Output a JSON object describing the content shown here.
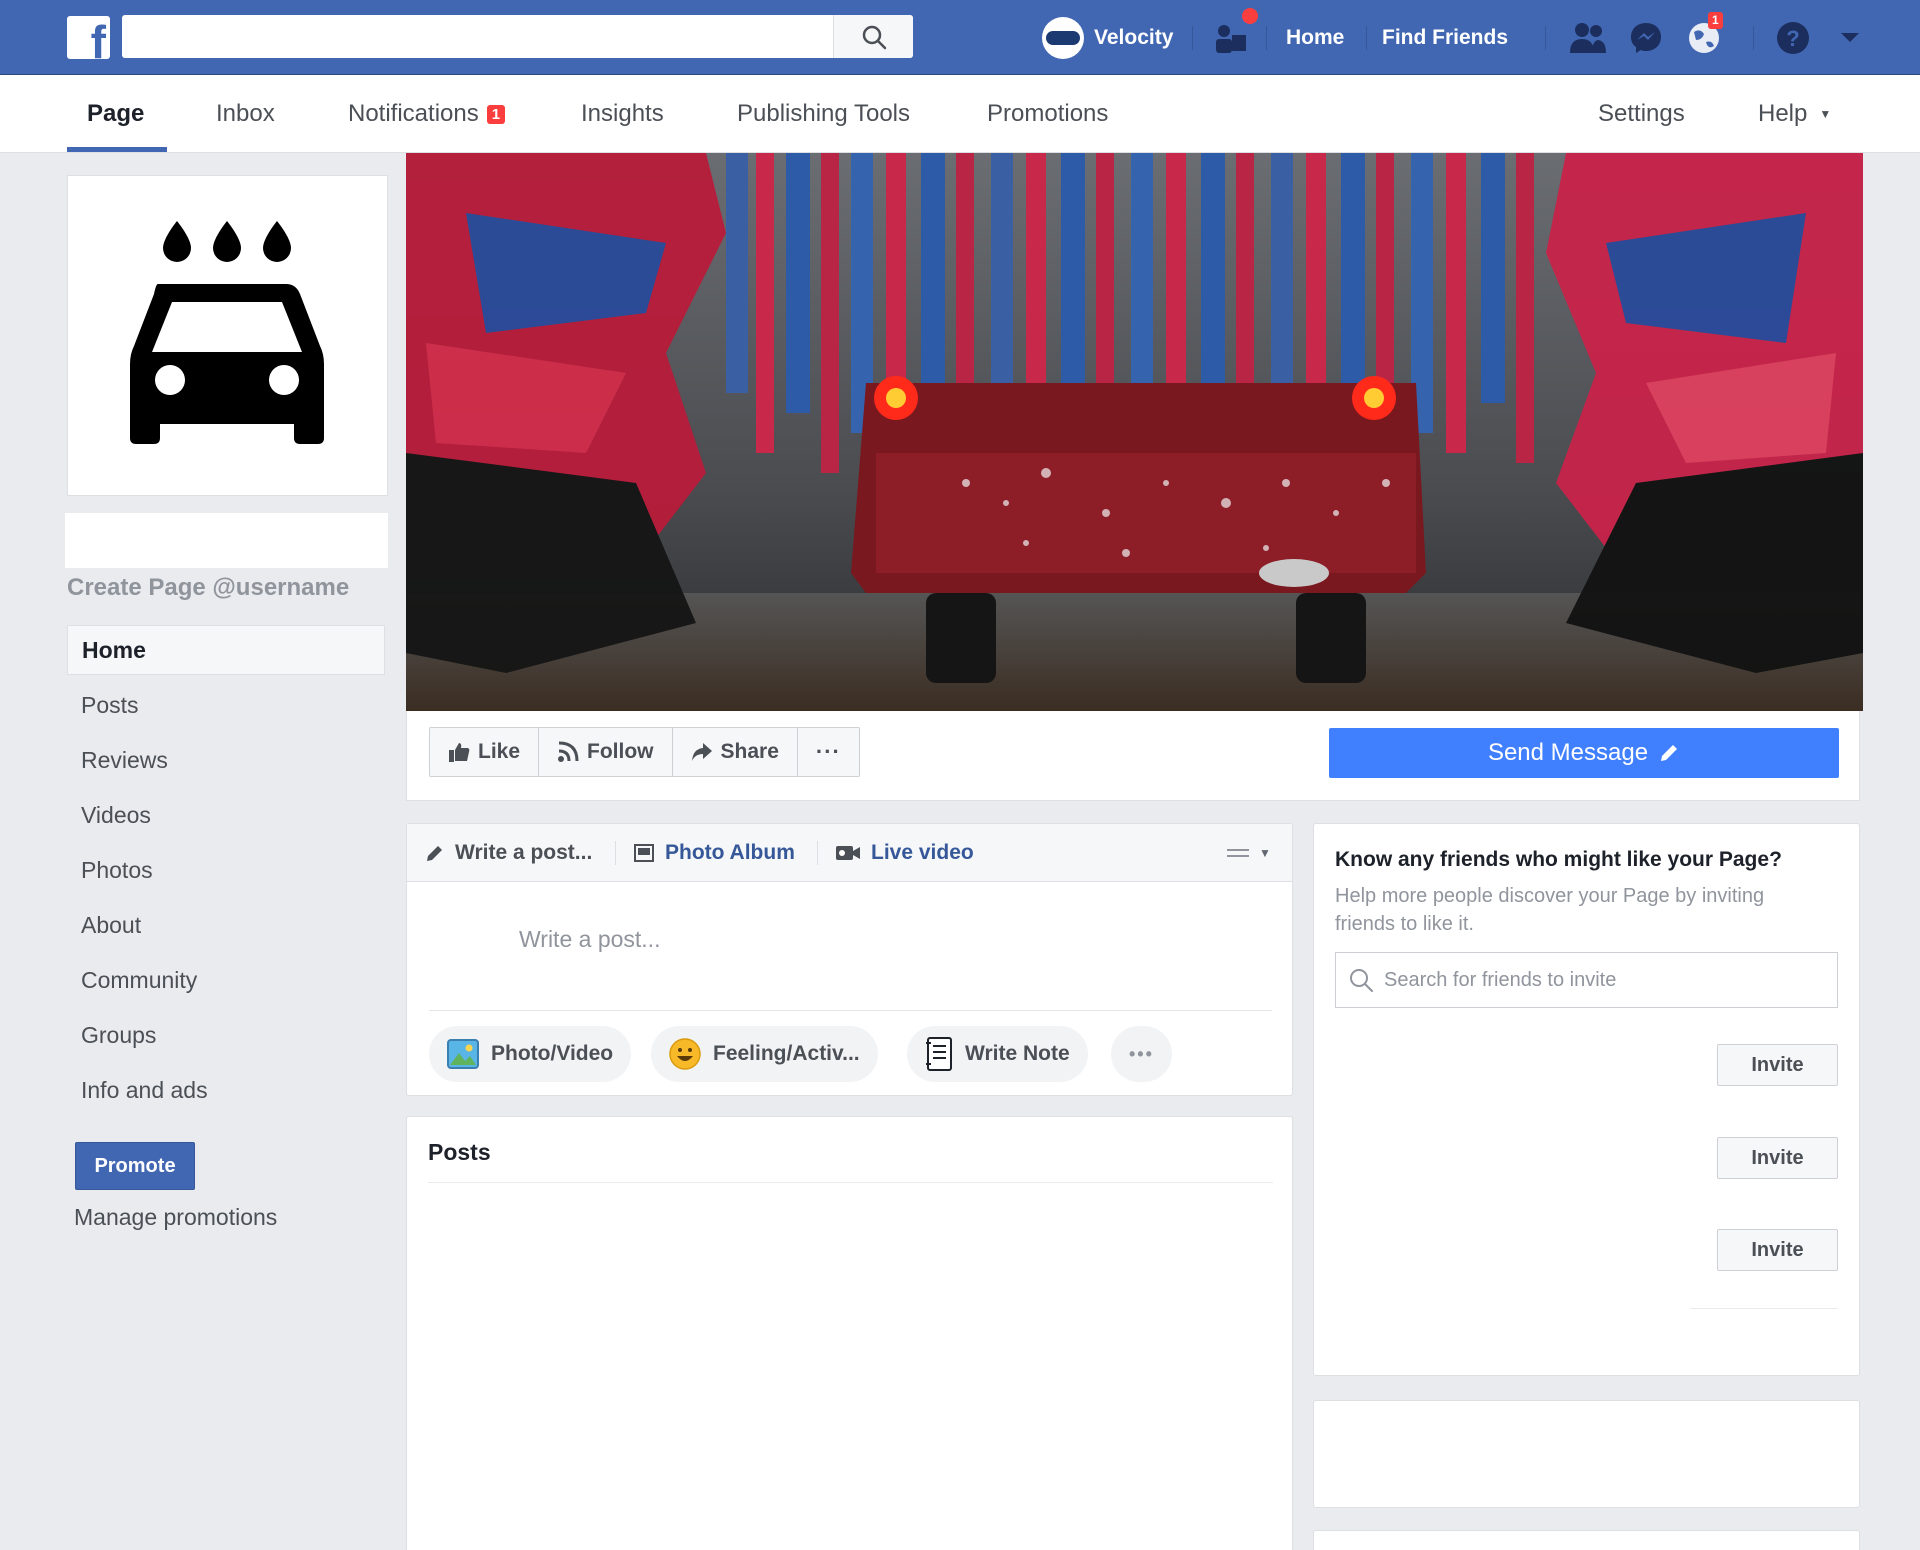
{
  "topbar": {
    "logo": "f",
    "search_placeholder": "",
    "profile_name": "Velocity",
    "home": "Home",
    "find_friends": "Find Friends",
    "notif_badge": "1",
    "color_bg": "#4267b2"
  },
  "page_tabs": {
    "page": "Page",
    "inbox": "Inbox",
    "notifications": "Notifications",
    "notifications_badge": "1",
    "insights": "Insights",
    "publishing_tools": "Publishing Tools",
    "promotions": "Promotions",
    "settings": "Settings",
    "help": "Help"
  },
  "sidebar": {
    "username_link": "Create Page @username",
    "items": [
      "Home",
      "Posts",
      "Reviews",
      "Videos",
      "Photos",
      "About",
      "Community",
      "Groups",
      "Info and ads"
    ],
    "promote": "Promote",
    "manage_promotions": "Manage promotions"
  },
  "actions": {
    "like": "Like",
    "follow": "Follow",
    "share": "Share",
    "more": "···",
    "send_message": "Send Message"
  },
  "composer": {
    "write_post": "Write a post...",
    "photo_album": "Photo Album",
    "live_video": "Live video",
    "input_placeholder": "Write a post...",
    "photo_video": "Photo/Video",
    "feeling": "Feeling/Activ...",
    "write_note": "Write Note",
    "more": "•••"
  },
  "posts": {
    "title": "Posts"
  },
  "invite": {
    "title": "Know any friends who might like your Page?",
    "description": "Help more people discover your Page by inviting friends to like it.",
    "search_placeholder": "Search for friends to invite",
    "buttons": [
      "Invite",
      "Invite",
      "Invite"
    ]
  },
  "colors": {
    "accent": "#4267b2",
    "send_message": "#4080ff",
    "badge": "#fa3e3e",
    "page_bg": "#e9ebee"
  }
}
